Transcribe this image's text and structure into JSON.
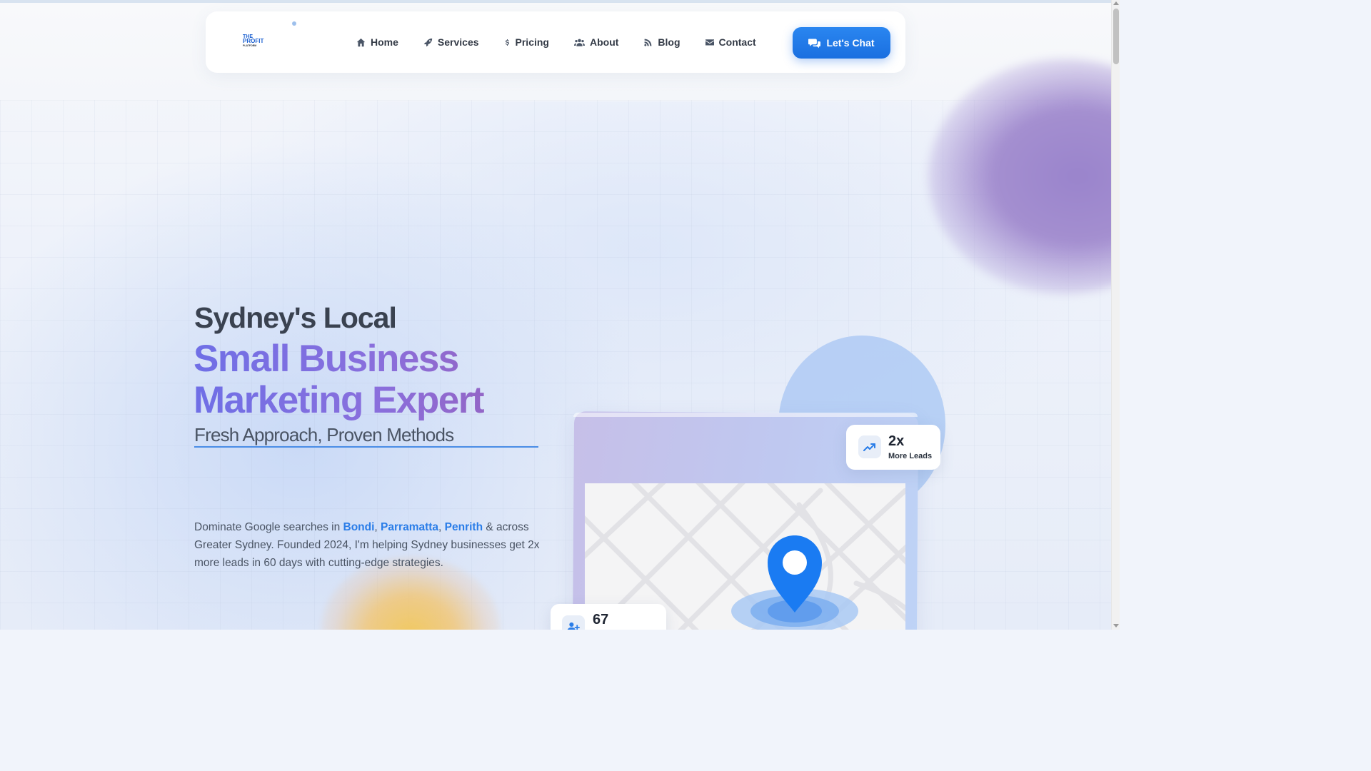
{
  "nav": {
    "logo_alt": "THE PROFIT PLATFORM",
    "items": [
      {
        "label": "Home",
        "icon": "home-icon"
      },
      {
        "label": "Services",
        "icon": "rocket-icon"
      },
      {
        "label": "Pricing",
        "icon": "dollar-icon"
      },
      {
        "label": "About",
        "icon": "users-icon"
      },
      {
        "label": "Blog",
        "icon": "blog-icon"
      },
      {
        "label": "Contact",
        "icon": "envelope-icon"
      }
    ],
    "cta_label": "Let's Chat",
    "cta_icon": "comments-icon"
  },
  "hero": {
    "pre_title": "Sydney's Local",
    "title_line1": "Small Business",
    "title_line2": "Marketing Expert",
    "subtitle": "Fresh Approach, Proven Methods",
    "desc_part1": "Dominate Google searches in ",
    "locations": [
      "Bondi",
      "Parramatta",
      "Penrith"
    ],
    "sep1": ", ",
    "sep2": ", ",
    "desc_part2": " & across Greater Sydney. Founded 2024, I'm helping Sydney businesses get 2x more leads in 60 days with cutting-edge strategies."
  },
  "stats": {
    "leads": {
      "value": "2x",
      "label": "More Leads",
      "icon": "trend-up-icon"
    },
    "clients": {
      "value": "67",
      "icon": "user-plus-icon"
    }
  },
  "colors": {
    "accent": "#1a6fe0",
    "link": "#2a7de8",
    "gradient_start": "#6f6fe6",
    "gradient_end": "#9a5fb6"
  }
}
